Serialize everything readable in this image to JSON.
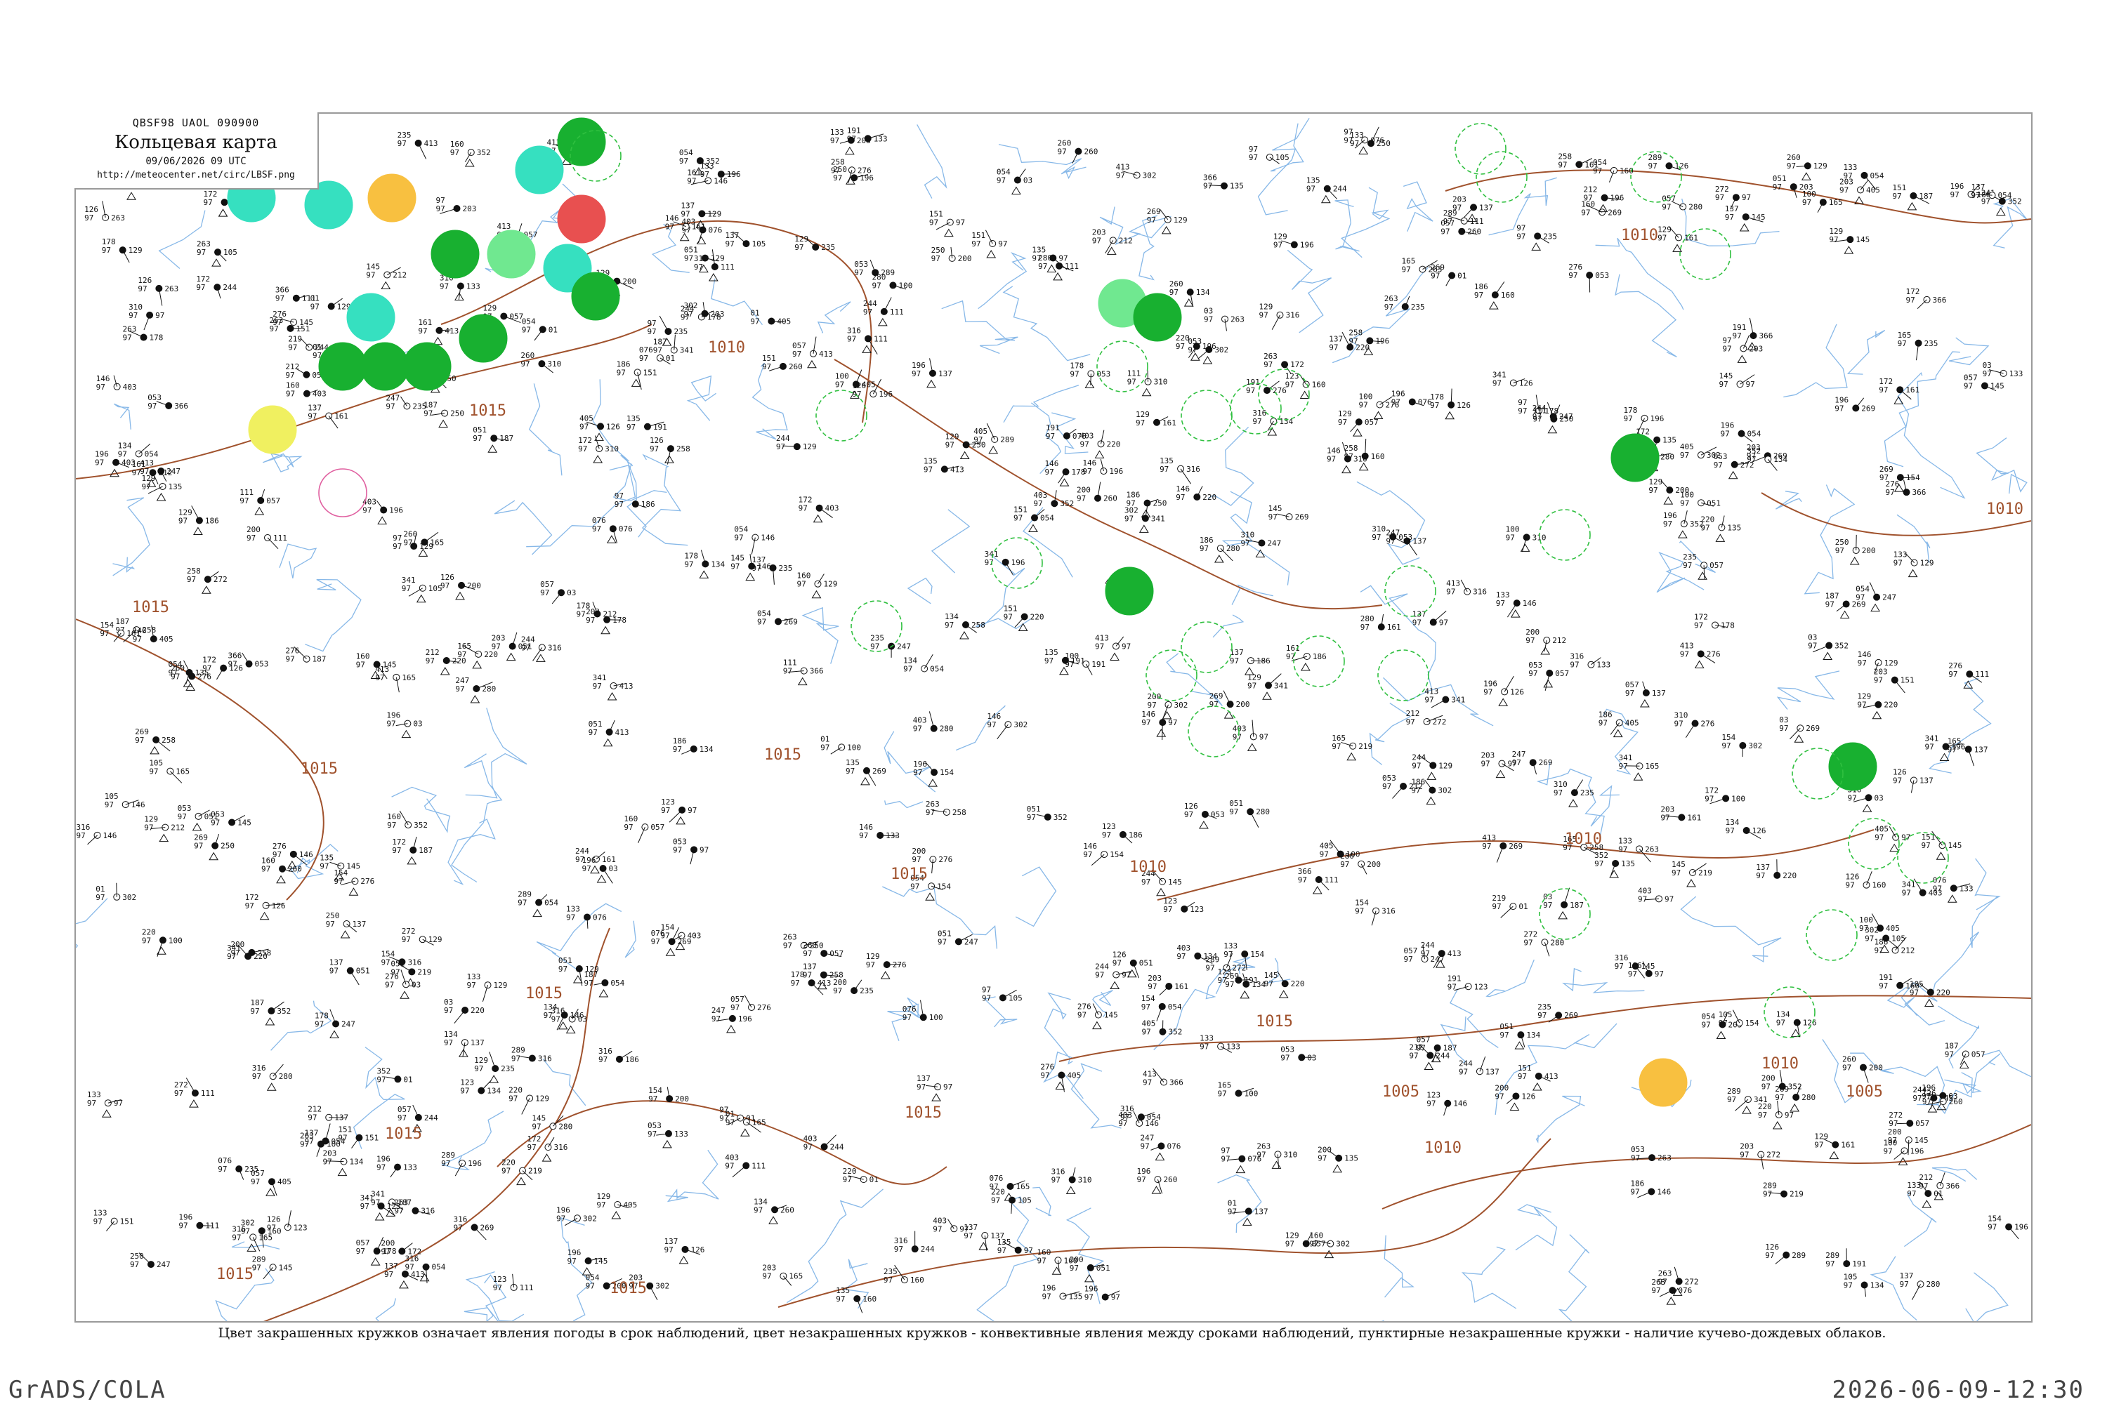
{
  "header": {
    "bulletin_code": "QBSF98  UAOL  090900",
    "title": "Кольцевая карта",
    "date": "09/06/2026 09 UTC",
    "url": "http://meteocenter.net/circ/LBSF.png"
  },
  "legend_text": "Цвет закрашенных кружков означает явления погоды в срок наблюдений, цвет незакрашенных кружков - конвективные явления между сроками наблюдений, пунктирные незакрашенные кружки - наличие кучево-дождевых облаков.",
  "footer": {
    "software": "GrADS/COLA",
    "timestamp": "2026-06-09-12:30"
  },
  "colors": {
    "isobar": "#a0522d",
    "river": "#87b8e8",
    "thunderstorm": "#18b030",
    "rain": "#36e0c0",
    "drizzle": "#70e890",
    "shower": "#e85050",
    "fog": "#f8c040",
    "haze": "#f0f060",
    "cb_dashed": "#30c040",
    "between_obs": "#e060a0"
  },
  "isobars": [
    {
      "label": "1010",
      "lines": 3
    },
    {
      "label": "1015",
      "lines": 4
    },
    {
      "label": "1005",
      "lines": 1
    }
  ],
  "isobar_labels": [
    "1010",
    "1015",
    "1015",
    "1015",
    "1015",
    "1015",
    "1015",
    "1015",
    "1015",
    "1010",
    "1010",
    "1010",
    "1010",
    "1010",
    "1010",
    "1005",
    "1005",
    "1015",
    "1015",
    "1015"
  ],
  "highlighted_stations": [
    {
      "kind": "thunderstorm",
      "values": [
        "174",
        "97",
        "07"
      ]
    },
    {
      "kind": "shower",
      "values": [
        "149",
        "97",
        "234"
      ]
    },
    {
      "kind": "rain",
      "values": [
        "143",
        "97",
        "58"
      ]
    },
    {
      "kind": "fog",
      "values": [
        "55",
        "97",
        "167"
      ]
    },
    {
      "kind": "haze",
      "values": [
        "156",
        "96",
        "123"
      ]
    },
    {
      "kind": "thunderstorm",
      "values": [
        "262",
        "97",
        "26"
      ]
    },
    {
      "kind": "fog",
      "values": [
        "392",
        "96",
        "07"
      ]
    }
  ],
  "station_sample_values": [
    "187",
    "100",
    "97",
    "03",
    "212",
    "105",
    "219",
    "135",
    "200",
    "137",
    "196",
    "134",
    "260",
    "123",
    "263",
    "269",
    "250",
    "129",
    "111",
    "247",
    "076",
    "161",
    "126",
    "191",
    "97",
    "01",
    "154",
    "146",
    "129",
    "178",
    "160",
    "133",
    "203",
    "186",
    "137",
    "258",
    "220",
    "235",
    "289",
    "276",
    "244",
    "145",
    "280",
    "172",
    "151",
    "196",
    "272",
    "165",
    "310",
    "341",
    "352",
    "403",
    "413",
    "366",
    "051",
    "405",
    "057",
    "316",
    "054",
    "302",
    "053"
  ]
}
